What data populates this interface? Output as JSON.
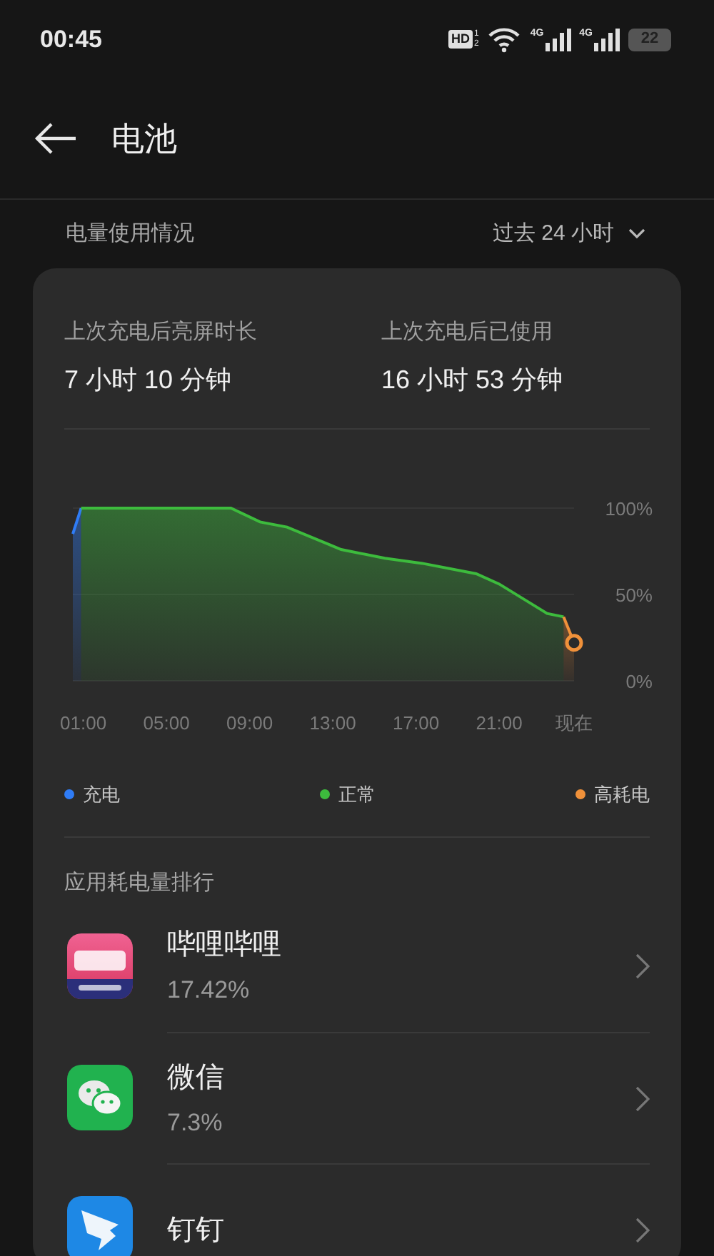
{
  "status_bar": {
    "time": "00:45",
    "hd": "HD",
    "hd_slots": [
      "1",
      "2"
    ],
    "networks": [
      {
        "label": "4G"
      },
      {
        "label": "4G"
      }
    ],
    "battery": "22"
  },
  "header": {
    "title": "电池"
  },
  "usage_section": {
    "title": "电量使用情况",
    "period": "过去 24 小时"
  },
  "stats": [
    {
      "label": "上次充电后亮屏时长",
      "value": "7 小时 10 分钟"
    },
    {
      "label": "上次充电后已使用",
      "value": "16 小时 53 分钟"
    }
  ],
  "chart_data": {
    "type": "area",
    "x": [
      0.5,
      0.9,
      8.1,
      9.5,
      10.8,
      13.4,
      15.5,
      17.3,
      19.9,
      21,
      23.3,
      24.1,
      24.6
    ],
    "series": [
      {
        "name": "充电",
        "color": "#2f7cf6",
        "values": [
          85,
          100,
          null,
          null,
          null,
          null,
          null,
          null,
          null,
          null,
          null,
          null,
          null
        ]
      },
      {
        "name": "正常",
        "color": "#3dbb3d",
        "values": [
          null,
          100,
          100,
          92,
          89,
          76,
          71,
          68,
          62,
          56,
          39,
          37,
          null
        ]
      },
      {
        "name": "高耗电",
        "color": "#f0913a",
        "values": [
          null,
          null,
          null,
          null,
          null,
          null,
          null,
          null,
          null,
          null,
          null,
          37,
          22
        ]
      }
    ],
    "xlim": [
      0.5,
      24.6
    ],
    "ylim": [
      0,
      100
    ],
    "xticks": [
      {
        "value": 1,
        "label": "01:00"
      },
      {
        "value": 5,
        "label": "05:00"
      },
      {
        "value": 9,
        "label": "09:00"
      },
      {
        "value": 13,
        "label": "13:00"
      },
      {
        "value": 17,
        "label": "17:00"
      },
      {
        "value": 21,
        "label": "21:00"
      },
      {
        "value": 24.6,
        "label": "现在"
      }
    ],
    "yticks": [
      {
        "value": 100,
        "label": "100%"
      },
      {
        "value": 50,
        "label": "50%"
      },
      {
        "value": 0,
        "label": "0%"
      }
    ]
  },
  "ranking": {
    "title": "应用耗电量排行",
    "apps": [
      {
        "kind": "pink",
        "name": "哔哩哔哩",
        "percent": "17.42%"
      },
      {
        "kind": "chat",
        "name": "微信",
        "percent": "7.3%"
      },
      {
        "kind": "wing",
        "name": "钉钉"
      }
    ]
  }
}
